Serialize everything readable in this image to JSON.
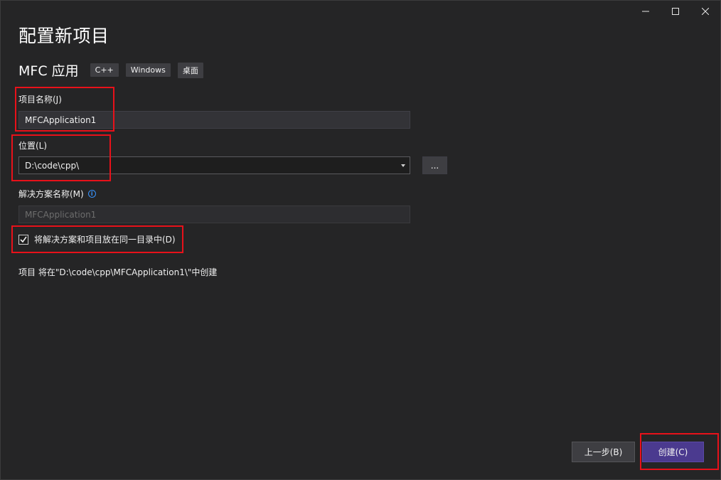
{
  "window": {
    "controls": {
      "minimize_icon": "minimize-icon",
      "maximize_icon": "maximize-icon",
      "close_icon": "close-icon"
    }
  },
  "page": {
    "title": "配置新项目",
    "template_name": "MFC 应用",
    "tags": [
      "C++",
      "Windows",
      "桌面"
    ]
  },
  "form": {
    "project_name": {
      "label": "项目名称(J)",
      "value": "MFCApplication1"
    },
    "location": {
      "label": "位置(L)",
      "value": "D:\\code\\cpp\\",
      "browse_label": "..."
    },
    "solution_name": {
      "label": "解决方案名称(M)",
      "value": "MFCApplication1",
      "info_icon": "info-icon"
    },
    "same_directory": {
      "label": "将解决方案和项目放在同一目录中(D)",
      "checked": true
    },
    "summary": "项目 将在\"D:\\code\\cpp\\MFCApplication1\\\"中创建"
  },
  "footer": {
    "back_label": "上一步(B)",
    "create_label": "创建(C)"
  },
  "colors": {
    "background": "#252526",
    "accent_button": "#4b3a8f",
    "highlight_box": "#e8111a",
    "info": "#3794ff"
  }
}
